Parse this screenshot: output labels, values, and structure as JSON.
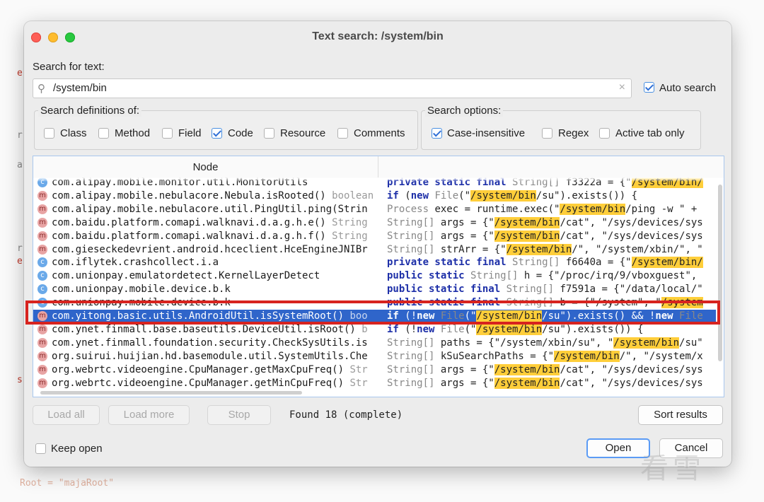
{
  "window": {
    "title": "Text search: /system/bin"
  },
  "search": {
    "label": "Search for text:",
    "value": "/system/bin",
    "auto_search_label": "Auto search",
    "auto_search_checked": true
  },
  "definitions": {
    "title": "Search definitions of:",
    "options": [
      {
        "label": "Class",
        "checked": false
      },
      {
        "label": "Method",
        "checked": false
      },
      {
        "label": "Field",
        "checked": false
      },
      {
        "label": "Code",
        "checked": true
      },
      {
        "label": "Resource",
        "checked": false
      },
      {
        "label": "Comments",
        "checked": false
      }
    ]
  },
  "search_options": {
    "title": "Search options:",
    "options": [
      {
        "label": "Case-insensitive",
        "checked": true
      },
      {
        "label": "Regex",
        "checked": false
      },
      {
        "label": "Active tab only",
        "checked": false
      }
    ]
  },
  "results": {
    "column_node": "Node",
    "rows": [
      {
        "icon": "c",
        "node": "com.alipay.mobile.monitor.util.MonitorUtils",
        "ntype": "",
        "code": [
          [
            "kw",
            "private static final "
          ],
          [
            "ty",
            "String[] "
          ],
          [
            "",
            "f3322a = {\""
          ],
          [
            "hl",
            "/system/bin/"
          ]
        ]
      },
      {
        "icon": "m",
        "node": "com.alipay.mobile.nebulacore.Nebula.isRooted() ",
        "ntype": "boolean",
        "code": [
          [
            "kw",
            "if "
          ],
          [
            "",
            "("
          ],
          [
            "kw",
            "new "
          ],
          [
            "ty",
            "File"
          ],
          [
            "",
            "(\""
          ],
          [
            "hl",
            "/system/bin"
          ],
          [
            "",
            "/su\").exists()) {"
          ]
        ]
      },
      {
        "icon": "m",
        "node": "com.alipay.mobile.nebulacore.util.PingUtil.ping(Strin",
        "ntype": "",
        "code": [
          [
            "ty",
            "Process "
          ],
          [
            "",
            "exec = runtime.exec(\""
          ],
          [
            "hl",
            "/system/bin"
          ],
          [
            "",
            "/ping -w \" + "
          ]
        ]
      },
      {
        "icon": "m",
        "node": "com.baidu.platform.comapi.walknavi.d.a.g.h.e() ",
        "ntype": "String",
        "code": [
          [
            "ty",
            "String[] "
          ],
          [
            "",
            "args = {\""
          ],
          [
            "hl",
            "/system/bin"
          ],
          [
            "",
            "/cat\", \"/sys/devices/sys"
          ]
        ]
      },
      {
        "icon": "m",
        "node": "com.baidu.platform.comapi.walknavi.d.a.g.h.f() ",
        "ntype": "String",
        "code": [
          [
            "ty",
            "String[] "
          ],
          [
            "",
            "args = {\""
          ],
          [
            "hl",
            "/system/bin"
          ],
          [
            "",
            "/cat\", \"/sys/devices/sys"
          ]
        ]
      },
      {
        "icon": "m",
        "node": "com.gieseckedevrient.android.hceclient.HceEngineJNIBr",
        "ntype": "",
        "code": [
          [
            "ty",
            "String[] "
          ],
          [
            "",
            "strArr = {\""
          ],
          [
            "hl",
            "/system/bin"
          ],
          [
            "",
            "/\", \"/system/xbin/\", \""
          ]
        ]
      },
      {
        "icon": "c",
        "node": "com.iflytek.crashcollect.i.a",
        "ntype": "",
        "code": [
          [
            "kw",
            "private static final "
          ],
          [
            "ty",
            "String[] "
          ],
          [
            "",
            "f6640a = {\""
          ],
          [
            "hl",
            "/system/bin/"
          ]
        ]
      },
      {
        "icon": "c",
        "node": "com.unionpay.emulatordetect.KernelLayerDetect",
        "ntype": "",
        "code": [
          [
            "kw",
            "public static "
          ],
          [
            "ty",
            "String[] "
          ],
          [
            "",
            "h = {\"/proc/irq/9/vboxguest\","
          ]
        ]
      },
      {
        "icon": "c",
        "node": "com.unionpay.mobile.device.b.k",
        "ntype": "",
        "code": [
          [
            "kw",
            "public static final "
          ],
          [
            "ty",
            "String[] "
          ],
          [
            "",
            "f7591a = {\"/data/local/\""
          ]
        ]
      },
      {
        "icon": "c",
        "node": "com.unionpay.mobile.device.b.k",
        "ntype": "",
        "code": [
          [
            "kw",
            "public static final "
          ],
          [
            "ty",
            "String[] "
          ],
          [
            "",
            "b = {\"/system\", \""
          ],
          [
            "hl",
            "/system"
          ]
        ]
      },
      {
        "icon": "m",
        "node": "com.yitong.basic.utils.AndroidUtil.isSystemRoot() ",
        "ntype": "boo",
        "selected": true,
        "code": [
          [
            "kw",
            "if "
          ],
          [
            "",
            "(!"
          ],
          [
            "kw",
            "new "
          ],
          [
            "ty",
            "File"
          ],
          [
            "",
            "(\""
          ],
          [
            "hl",
            "/system/bin"
          ],
          [
            "",
            "/su\").exists() && !"
          ],
          [
            "kw",
            "new "
          ],
          [
            "ty",
            "File"
          ]
        ]
      },
      {
        "icon": "m",
        "node": "com.ynet.finmall.base.baseutils.DeviceUtil.isRoot() ",
        "ntype": "b",
        "code": [
          [
            "kw",
            "if "
          ],
          [
            "",
            "(!"
          ],
          [
            "kw",
            "new "
          ],
          [
            "ty",
            "File"
          ],
          [
            "",
            "(\""
          ],
          [
            "hl",
            "/system/bin"
          ],
          [
            "",
            "/su\").exists()) {"
          ]
        ]
      },
      {
        "icon": "m",
        "node": "com.ynet.finmall.foundation.security.CheckSysUtils.is",
        "ntype": "",
        "code": [
          [
            "ty",
            "String[] "
          ],
          [
            "",
            "paths = {\"/system/xbin/su\", \""
          ],
          [
            "hl",
            "/system/bin"
          ],
          [
            "",
            "/su\""
          ]
        ]
      },
      {
        "icon": "m",
        "node": "org.suirui.huijian.hd.basemodule.util.SystemUtils.Che",
        "ntype": "",
        "code": [
          [
            "ty",
            "String[] "
          ],
          [
            "",
            "kSuSearchPaths = {\""
          ],
          [
            "hl",
            "/system/bin"
          ],
          [
            "",
            "/\", \"/system/x"
          ]
        ]
      },
      {
        "icon": "m",
        "node": "org.webrtc.videoengine.CpuManager.getMaxCpuFreq() ",
        "ntype": "Str",
        "code": [
          [
            "ty",
            "String[] "
          ],
          [
            "",
            "args = {\""
          ],
          [
            "hl",
            "/system/bin"
          ],
          [
            "",
            "/cat\", \"/sys/devices/sys"
          ]
        ]
      },
      {
        "icon": "m",
        "node": "org.webrtc.videoengine.CpuManager.getMinCpuFreq() ",
        "ntype": "Str",
        "code": [
          [
            "ty",
            "String[] "
          ],
          [
            "",
            "args = {\""
          ],
          [
            "hl",
            "/system/bin"
          ],
          [
            "",
            "/cat\", \"/sys/devices/sys"
          ]
        ]
      }
    ]
  },
  "footer": {
    "load_all": "Load all",
    "load_more": "Load more",
    "stop": "Stop",
    "found": "Found 18 (complete)",
    "sort_results": "Sort results",
    "keep_open": "Keep open",
    "open": "Open",
    "cancel": "Cancel"
  },
  "background": {
    "bottom_text": "Root = \"majaRoot\""
  },
  "colors": {
    "highlight": "#ffce3a",
    "selection": "#2f65ca",
    "annotation_box": "#d7231f",
    "keyword": "#1d2fa8"
  }
}
